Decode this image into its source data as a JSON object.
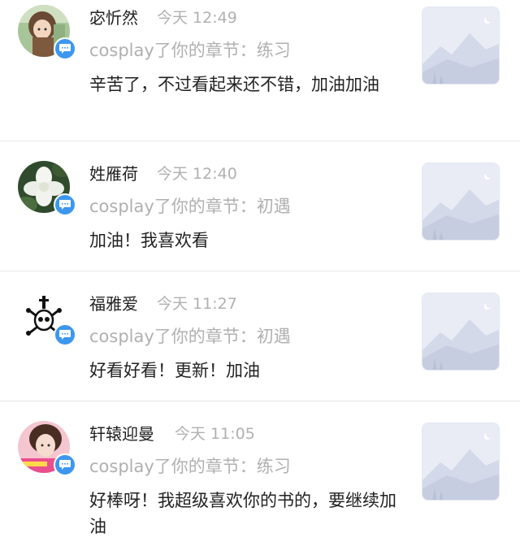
{
  "notifications": [
    {
      "name": "宓忻然",
      "time": "今天 12:49",
      "action": "cosplay了你的章节：练习",
      "comment": "辛苦了，不过看起来还不错，加油加油",
      "avatar_icon": "anime-girl-avatar"
    },
    {
      "name": "姓雁荷",
      "time": "今天 12:40",
      "action": "cosplay了你的章节：初遇",
      "comment": "加油！我喜欢看",
      "avatar_icon": "white-flower-avatar"
    },
    {
      "name": "福雅爱",
      "time": "今天 11:27",
      "action": "cosplay了你的章节：初遇",
      "comment": "好看好看！更新！加油",
      "avatar_icon": "skull-crossbones-avatar"
    },
    {
      "name": "轩辕迎曼",
      "time": "今天 11:05",
      "action": "cosplay了你的章节：练习",
      "comment": "好棒呀！我超级喜欢你的书的，要继续加油",
      "avatar_icon": "pink-girl-avatar"
    }
  ],
  "colors": {
    "badge": "#3d97ef",
    "secondary_text": "#b0b0b0",
    "primary_text": "#222222",
    "thumb_bg": "#e9ecf5"
  },
  "thumbnail_icon": "mountain-placeholder-icon",
  "badge_icon": "chat-bubble-icon"
}
